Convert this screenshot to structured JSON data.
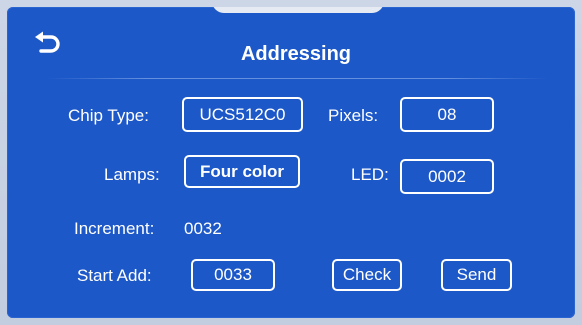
{
  "title": "Addressing",
  "chip_type": {
    "label": "Chip Type:",
    "value": "UCS512C0"
  },
  "pixels": {
    "label": "Pixels:",
    "value": "08"
  },
  "lamps": {
    "label": "Lamps:",
    "value": "Four color"
  },
  "led": {
    "label": "LED:",
    "value": "0002"
  },
  "increment": {
    "label": "Increment:",
    "value": "0032"
  },
  "start_add": {
    "label": "Start Add:",
    "value": "0033"
  },
  "buttons": {
    "check": "Check",
    "send": "Send"
  },
  "colors": {
    "panel": "#1d58c8",
    "text": "#ffffff",
    "background": "#c9d3e3"
  },
  "icons": {
    "back": "back-arrow-icon"
  }
}
